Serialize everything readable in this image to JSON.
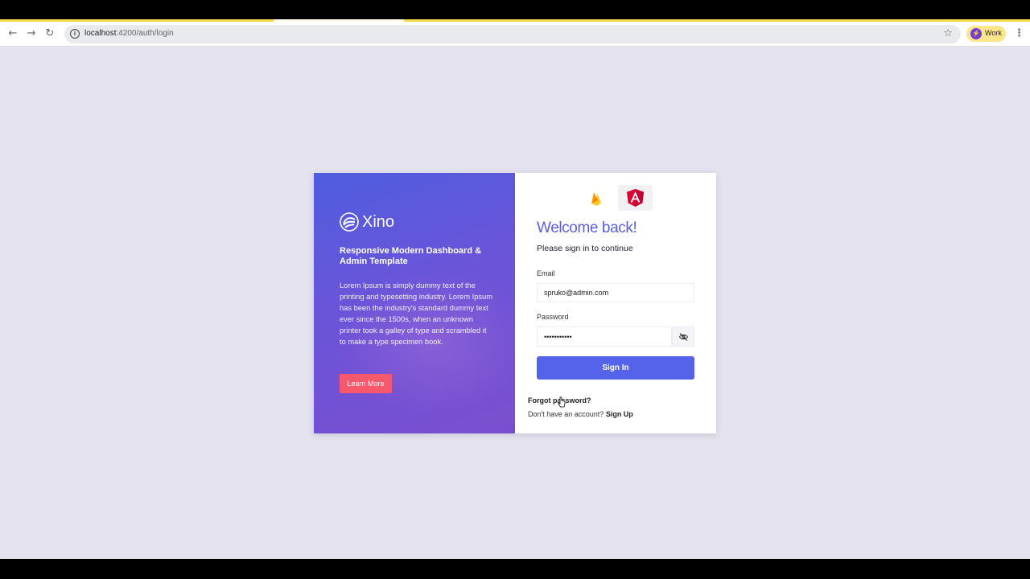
{
  "browser": {
    "url_host": "localhost",
    "url_path": ":4200/auth/login",
    "profile_label": "Work",
    "back_icon": "arrow-left-icon",
    "forward_icon": "arrow-right-icon",
    "reload_icon": "reload-icon",
    "bookmark_icon": "star-icon",
    "menu_icon": "kebab-menu-icon"
  },
  "promo": {
    "brand_name": "Xino",
    "title": "Responsive Modern Dashboard & Admin Template",
    "text": "Lorem Ipsum is simply dummy text of the printing and typesetting industry. Lorem Ipsum has been the industry's standard dummy text ever since the 1500s, when an unknown printer took a galley of type and scrambled it to make a type specimen book.",
    "learn_more_label": "Learn More",
    "button_color": "#f7586b"
  },
  "login": {
    "welcome": "Welcome back!",
    "subtitle": "Please sign in to continue",
    "email_label": "Email",
    "email_value": "spruko@admin.com",
    "password_label": "Password",
    "password_value": "•••••••••••",
    "sign_in_label": "Sign In",
    "forgot_label": "Forgot password?",
    "no_account_text": "Don't have an account?",
    "sign_up_label": "Sign Up",
    "accent_color": "#5563ea"
  }
}
